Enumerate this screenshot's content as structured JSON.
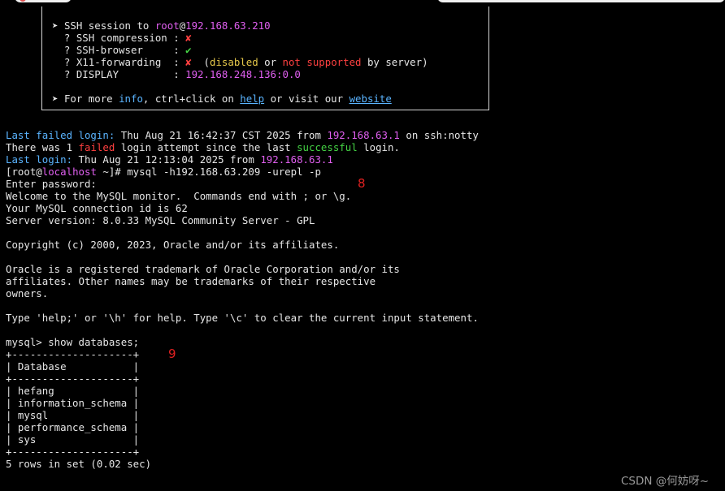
{
  "ssh_box": {
    "arrow": "➤",
    "session_prefix": "SSH session to ",
    "session_user": "root",
    "session_at": "@",
    "session_host": "192.168.63.210",
    "compression_label": "? SSH compression : ",
    "compression_mark": "✘",
    "browser_label": "? SSH-browser     : ",
    "browser_mark": "✔",
    "x11_label": "? X11-forwarding  : ",
    "x11_mark": "✘",
    "x11_open": "  (",
    "x11_disabled": "disabled",
    "x11_or": " or ",
    "x11_not_supported": "not supported",
    "x11_by_server": " by server)",
    "display_label": "? DISPLAY         : ",
    "display_value": "192.168.248.136:0.0",
    "info_prefix": "For more ",
    "info_word": "info",
    "info_mid": ", ctrl+click on ",
    "help_link": "help",
    "info_mid2": " or visit our ",
    "website_link": "website"
  },
  "terminal": {
    "failed_login_label": "Last failed login:",
    "failed_login_rest": " Thu Aug 21 16:42:37 CST 2025 from ",
    "failed_login_ip": "192.168.63.1",
    "failed_login_tail": " on ssh:notty",
    "there_was": "There was 1 ",
    "failed_word": "failed",
    "attempt_mid": " login attempt since the last ",
    "successful_word": "successful",
    "attempt_tail": " login.",
    "last_login_label": "Last login:",
    "last_login_rest": " Thu Aug 21 12:13:04 2025 from ",
    "last_login_ip": "192.168.63.1",
    "prompt_open": "[root@",
    "prompt_host": "localhost",
    "prompt_close": " ~]# ",
    "command": "mysql -h192.168.63.209 -urepl -p",
    "enter_password": "Enter password:",
    "welcome": "Welcome to the MySQL monitor.  Commands end with ; or \\g.",
    "connection_id": "Your MySQL connection id is 62",
    "server_version": "Server version: 8.0.33 MySQL Community Server - GPL",
    "copyright": "Copyright (c) 2000, 2023, Oracle and/or its affiliates.",
    "oracle_1": "Oracle is a registered trademark of Oracle Corporation and/or its",
    "oracle_2": "affiliates. Other names may be trademarks of their respective",
    "oracle_3": "owners.",
    "help_line": "Type 'help;' or '\\h' for help. Type '\\c' to clear the current input statement.",
    "mysql_prompt": "mysql> show databases;",
    "table_border": "+--------------------+",
    "table_header": "| Database           |",
    "rows": [
      "| hefang             |",
      "| information_schema |",
      "| mysql              |",
      "| performance_schema |",
      "| sys                |"
    ],
    "rows_in_set": "5 rows in set (0.02 sec)"
  },
  "annotations": {
    "step_8": "8",
    "step_9": "9"
  },
  "watermark": "CSDN @何妨呀~"
}
